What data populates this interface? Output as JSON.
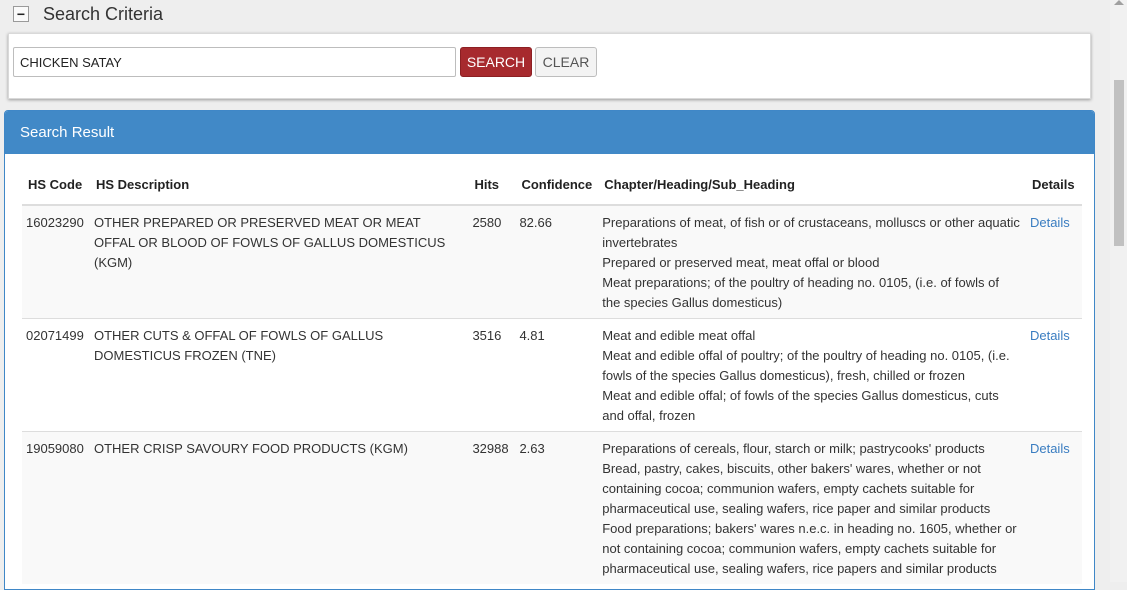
{
  "criteria": {
    "toggle_symbol": "−",
    "title": "Search Criteria",
    "input_value": "CHICKEN SATAY",
    "search_label": "SEARCH",
    "clear_label": "CLEAR"
  },
  "results": {
    "title": "Search Result",
    "columns": {
      "hs_code": "HS Code",
      "hs_description": "HS Description",
      "hits": "Hits",
      "confidence": "Confidence",
      "chapter": "Chapter/Heading/Sub_Heading",
      "details": "Details"
    },
    "rows": [
      {
        "hs_code": "16023290",
        "hs_description": "OTHER PREPARED OR PRESERVED MEAT OR MEAT OFFAL OR BLOOD OF FOWLS OF GALLUS DOMESTICUS (KGM)",
        "hits": "2580",
        "confidence": "82.66",
        "chapter": "Preparations of meat, of fish or of crustaceans, molluscs or other aquatic invertebrates",
        "heading": "Prepared or preserved meat, meat offal or blood",
        "sub_heading": "Meat preparations; of the poultry of heading no. 0105, (i.e. of fowls of the species Gallus domesticus)",
        "details": "Details"
      },
      {
        "hs_code": "02071499",
        "hs_description": "OTHER CUTS & OFFAL OF FOWLS OF GALLUS DOMESTICUS FROZEN (TNE)",
        "hits": "3516",
        "confidence": "4.81",
        "chapter": "Meat and edible meat offal",
        "heading": "Meat and edible offal of poultry; of the poultry of heading no. 0105, (i.e. fowls of the species Gallus domesticus), fresh, chilled or frozen",
        "sub_heading": "Meat and edible offal; of fowls of the species Gallus domesticus, cuts and offal, frozen",
        "details": "Details"
      },
      {
        "hs_code": "19059080",
        "hs_description": "OTHER CRISP SAVOURY FOOD PRODUCTS (KGM)",
        "hits": "32988",
        "confidence": "2.63",
        "chapter": "Preparations of cereals, flour, starch or milk; pastrycooks' products",
        "heading": "Bread, pastry, cakes, biscuits, other bakers' wares, whether or not containing cocoa; communion wafers, empty cachets suitable for pharmaceutical use, sealing wafers, rice paper and similar products",
        "sub_heading": "Food preparations; bakers' wares n.e.c. in heading no. 1605, whether or not containing cocoa; communion wafers, empty cachets suitable for pharmaceutical use, sealing wafers, rice papers and similar products",
        "details": "Details"
      }
    ]
  }
}
